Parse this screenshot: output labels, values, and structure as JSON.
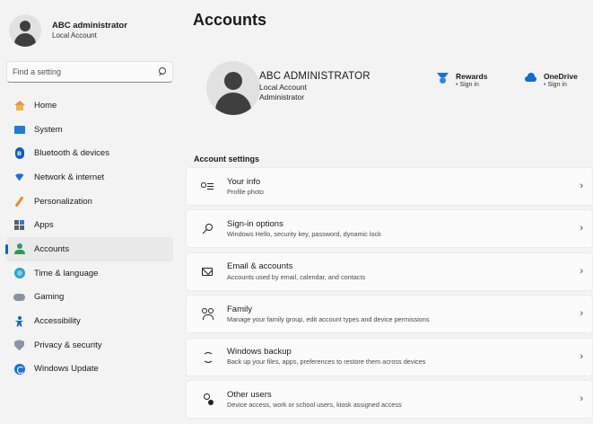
{
  "sidebar": {
    "user": {
      "name": "ABC administrator",
      "subtitle": "Local Account"
    },
    "search": {
      "placeholder": "Find a setting"
    },
    "items": [
      {
        "label": "Home",
        "icon": "home-icon"
      },
      {
        "label": "System",
        "icon": "system-icon"
      },
      {
        "label": "Bluetooth & devices",
        "icon": "bluetooth-icon"
      },
      {
        "label": "Network & internet",
        "icon": "wifi-icon"
      },
      {
        "label": "Personalization",
        "icon": "pen-icon"
      },
      {
        "label": "Apps",
        "icon": "apps-icon"
      },
      {
        "label": "Accounts",
        "icon": "accounts-icon",
        "selected": true
      },
      {
        "label": "Time & language",
        "icon": "globe-clock-icon"
      },
      {
        "label": "Gaming",
        "icon": "controller-icon"
      },
      {
        "label": "Accessibility",
        "icon": "accessibility-icon"
      },
      {
        "label": "Privacy & security",
        "icon": "shield-icon"
      },
      {
        "label": "Windows Update",
        "icon": "update-icon"
      }
    ]
  },
  "main": {
    "title": "Accounts",
    "profile": {
      "name": "ABC ADMINISTRATOR",
      "account_type": "Local Account",
      "role": "Administrator"
    },
    "services": [
      {
        "title": "Rewards",
        "status": "Sign in",
        "icon": "rewards-trophy-icon"
      },
      {
        "title": "OneDrive",
        "status": "Sign in",
        "icon": "onedrive-cloud-icon"
      }
    ],
    "section_title": "Account settings",
    "cards": [
      {
        "title": "Your info",
        "subtitle": "Profile photo",
        "icon": "person-info-icon"
      },
      {
        "title": "Sign-in options",
        "subtitle": "Windows Hello, security key, password, dynamic lock",
        "icon": "key-icon"
      },
      {
        "title": "Email & accounts",
        "subtitle": "Accounts used by email, calendar, and contacts",
        "icon": "mail-icon"
      },
      {
        "title": "Family",
        "subtitle": "Manage your family group, edit account types and device permissions",
        "icon": "family-icon"
      },
      {
        "title": "Windows backup",
        "subtitle": "Back up your files, apps, preferences to restore them across devices",
        "icon": "backup-sync-icon"
      },
      {
        "title": "Other users",
        "subtitle": "Device access, work or school users, kiosk assigned access",
        "icon": "other-users-icon"
      }
    ]
  },
  "colors": {
    "accent": "#0067c0",
    "background": "#f3f3f3",
    "card": "#fbfbfb"
  }
}
